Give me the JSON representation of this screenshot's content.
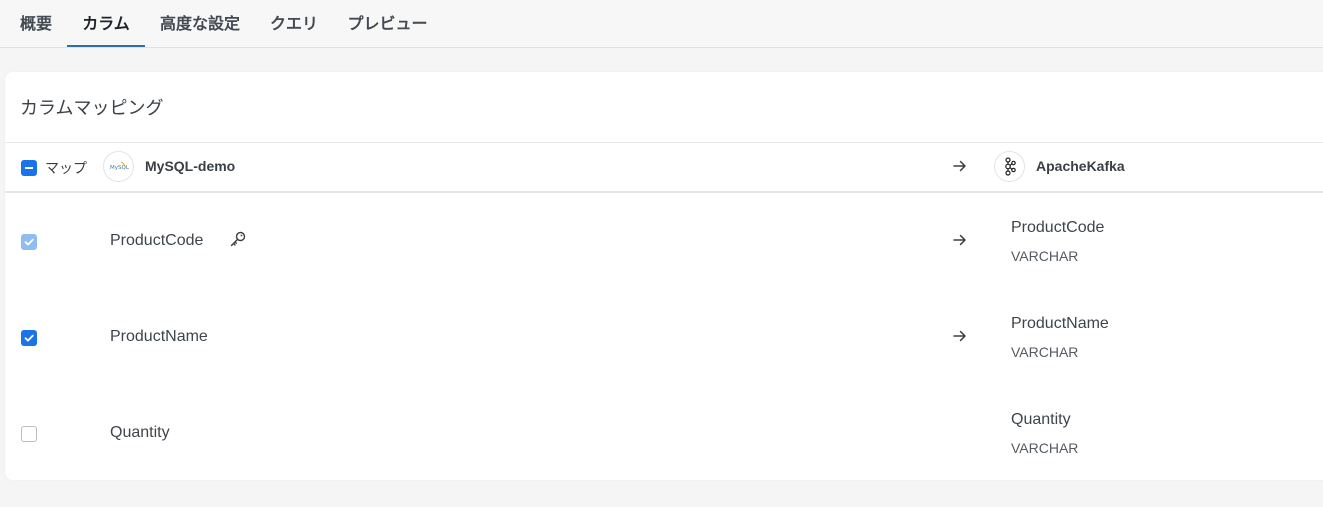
{
  "tabs": [
    {
      "label": "概要"
    },
    {
      "label": "カラム"
    },
    {
      "label": "高度な設定"
    },
    {
      "label": "クエリ"
    },
    {
      "label": "プレビュー"
    }
  ],
  "active_tab": "カラム",
  "card": {
    "title": "カラムマッピング",
    "header": {
      "map_label": "マップ",
      "source_logo_text": "MySQL",
      "source_name": "MySQL-demo",
      "target_name": "ApacheKafka"
    },
    "rows": [
      {
        "source": "ProductCode",
        "has_key": true,
        "checked": true,
        "locked": true,
        "target": "ProductCode",
        "type": "VARCHAR",
        "mapped": true
      },
      {
        "source": "ProductName",
        "has_key": false,
        "checked": true,
        "locked": false,
        "target": "ProductName",
        "type": "VARCHAR",
        "mapped": true
      },
      {
        "source": "Quantity",
        "has_key": false,
        "checked": false,
        "locked": false,
        "target": "Quantity",
        "type": "VARCHAR",
        "mapped": false
      }
    ]
  },
  "colors": {
    "accent": "#1a73e8",
    "tab_underline": "#2f6fa6",
    "checkbox_disabled": "#90bdf0"
  },
  "icons": {
    "key": "key-icon",
    "arrow": "arrow-right-icon",
    "kafka": "kafka-icon",
    "mysql": "mysql-logo"
  }
}
